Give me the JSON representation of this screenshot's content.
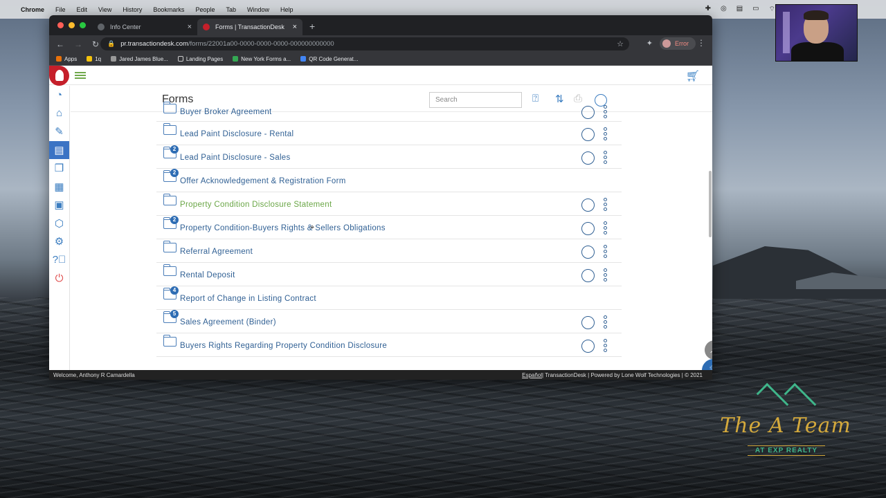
{
  "menubar": {
    "app": "Chrome",
    "items": [
      "File",
      "Edit",
      "View",
      "History",
      "Bookmarks",
      "People",
      "Tab",
      "Window",
      "Help"
    ]
  },
  "browser": {
    "tabs": [
      {
        "title": "Info Center",
        "active": false
      },
      {
        "title": "Forms | TransactionDesk",
        "active": true
      }
    ],
    "url_host": "pr.transactiondesk.com",
    "url_path": "/forms/22001a00-0000-0000-0000-000000000000",
    "profile_status": "Error",
    "bookmarks": [
      "Apps",
      "1q",
      "Jared James Blue...",
      "Landing Pages",
      "New York Forms a...",
      "QR Code Generat..."
    ]
  },
  "page": {
    "title": "Forms",
    "search_placeholder": "Search"
  },
  "forms": [
    {
      "label": "Buyer Broker Agreement",
      "badge": "",
      "has_actions": true,
      "highlight": false
    },
    {
      "label": "Lead Paint Disclosure - Rental",
      "badge": "",
      "has_actions": true,
      "highlight": false
    },
    {
      "label": "Lead Paint Disclosure - Sales",
      "badge": "2",
      "has_actions": true,
      "highlight": false
    },
    {
      "label": "Offer Acknowledgement & Registration Form",
      "badge": "2",
      "has_actions": false,
      "highlight": false
    },
    {
      "label": "Property Condition Disclosure Statement",
      "badge": "",
      "has_actions": true,
      "highlight": true
    },
    {
      "label": "Property Condition-Buyers Rights & Sellers Obligations",
      "badge": "2",
      "has_actions": true,
      "highlight": false
    },
    {
      "label": "Referral Agreement",
      "badge": "",
      "has_actions": true,
      "highlight": false
    },
    {
      "label": "Rental Deposit",
      "badge": "",
      "has_actions": true,
      "highlight": false
    },
    {
      "label": "Report of Change in Listing Contract",
      "badge": "4",
      "has_actions": false,
      "highlight": false
    },
    {
      "label": "Sales Agreement (Binder)",
      "badge": "5",
      "has_actions": true,
      "highlight": false
    },
    {
      "label": "Buyers Rights Regarding Property Condition Disclosure",
      "badge": "",
      "has_actions": true,
      "highlight": false
    }
  ],
  "footer": {
    "welcome": "Welcome, Anthony R Camardella",
    "lang": "Español",
    "rights": "| TransactionDesk | Powered by Lone Wolf Technologies | © 2021"
  },
  "brand": {
    "name": "The A Team",
    "sub": "AT EXP REALTY"
  },
  "colors": {
    "accent": "#2e6db4",
    "highlight_text": "#6aa646",
    "logo_red": "#c51f2a"
  }
}
